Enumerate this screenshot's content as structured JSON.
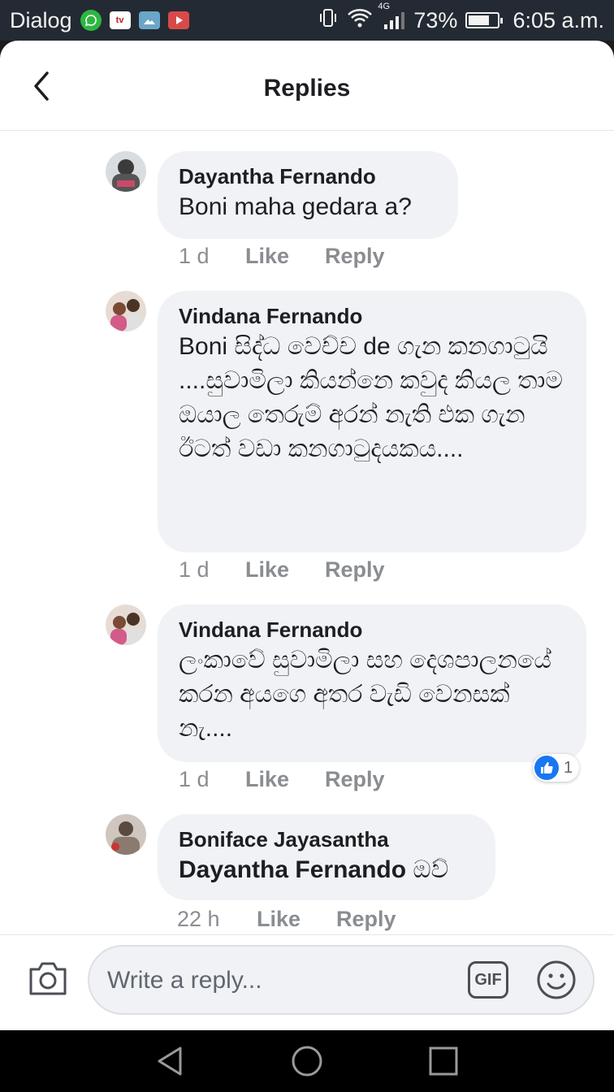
{
  "status_bar": {
    "carrier": "Dialog",
    "network": "4G",
    "battery": "73%",
    "battery_level": 0.73,
    "time": "6:05 a.m.",
    "tv_icon_text": "tv"
  },
  "header": {
    "title": "Replies"
  },
  "comments": [
    {
      "author": "Dayantha Fernando",
      "text": "Boni maha gedara a?",
      "time": "1 d",
      "like_label": "Like",
      "reply_label": "Reply"
    },
    {
      "author": "Vindana Fernando",
      "text": "Boni සිද්ධ වෙච්ච de ගැන කනගාටුයි ....සුවාමිලා කියන්නෙ කවුද කියල තාම ඔයාල තෙරුම් අරන් නැති එක ගැන ඊටත් වඩා කනගාටුදයකය....",
      "time": "1 d",
      "like_label": "Like",
      "reply_label": "Reply"
    },
    {
      "author": "Vindana Fernando",
      "text": "ලංකාවේ සුවාමිලා සහ දෙශපාලනයේ කරන අයගෙ අතර වැඩි වෙනසක් නැ....",
      "time": "1 d",
      "like_label": "Like",
      "reply_label": "Reply",
      "reaction": {
        "icon": "like-icon",
        "count": "1"
      }
    },
    {
      "author": "Boniface Jayasantha",
      "mention": "Dayantha Fernando",
      "text": " ඔව්",
      "time": "22 h",
      "like_label": "Like",
      "reply_label": "Reply"
    }
  ],
  "composer": {
    "placeholder": "Write a reply...",
    "gif_label": "GIF"
  },
  "colors": {
    "accent": "#1877f2",
    "bubble": "#f0f2f5",
    "meta": "#8a8d91",
    "statusbar": "#242a33"
  }
}
